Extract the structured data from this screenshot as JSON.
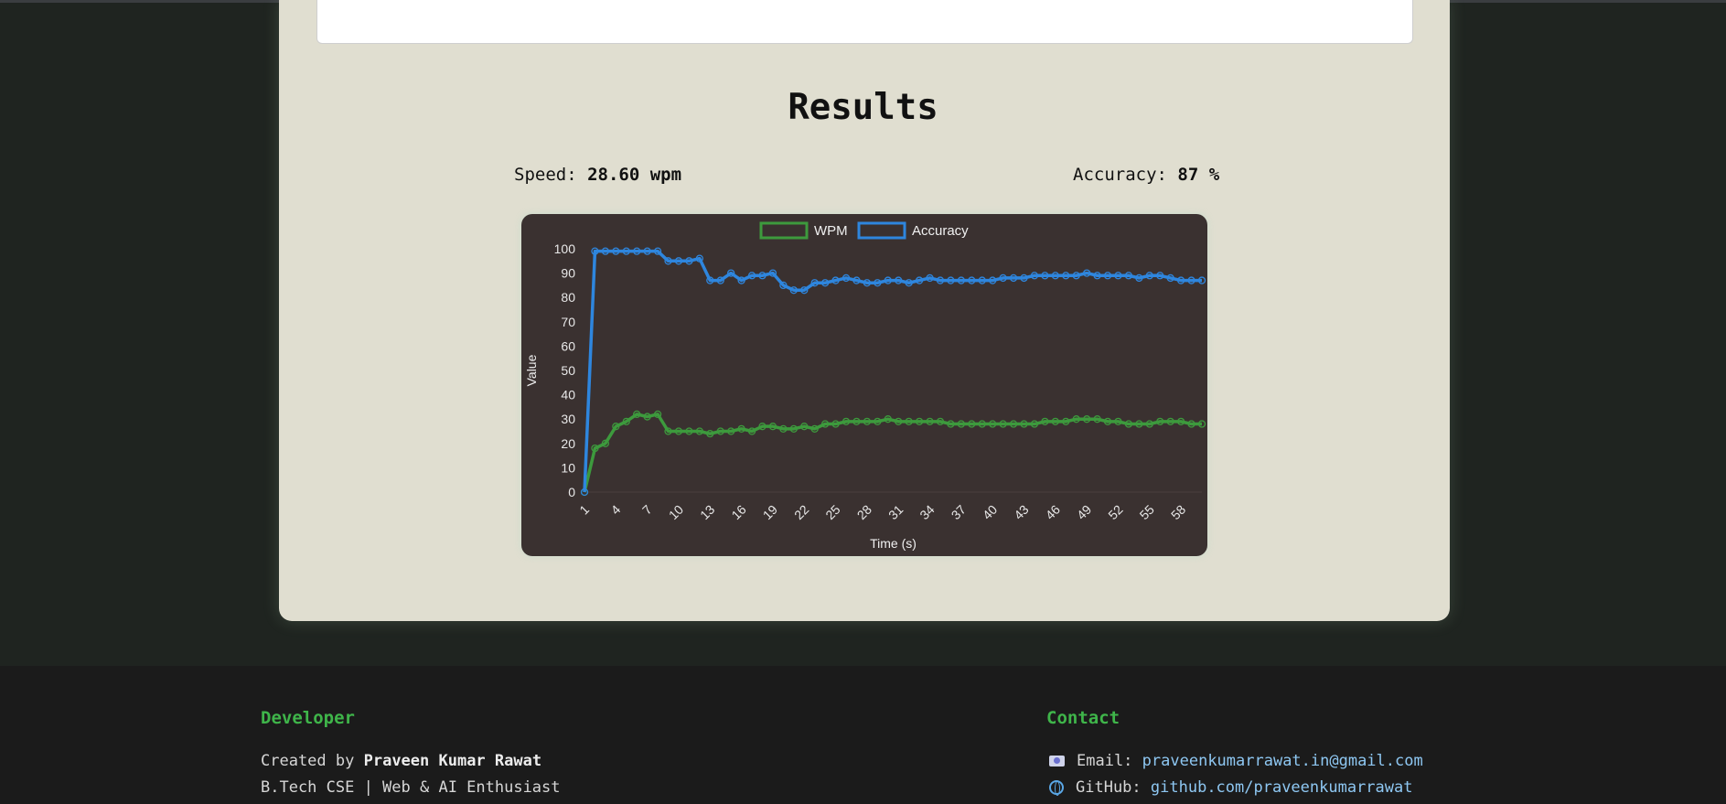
{
  "results": {
    "title": "Results",
    "speed_label": "Speed:",
    "speed_value": "28.60 wpm",
    "accuracy_label": "Accuracy:",
    "accuracy_value": "87 %"
  },
  "chart_data": {
    "type": "line",
    "xlabel": "Time (s)",
    "ylabel": "Value",
    "ylim": [
      0,
      100
    ],
    "y_ticks": [
      0,
      10,
      20,
      30,
      40,
      50,
      60,
      70,
      80,
      90,
      100
    ],
    "x_tick_labels": [
      "1",
      "4",
      "7",
      "10",
      "13",
      "16",
      "19",
      "22",
      "25",
      "28",
      "31",
      "34",
      "37",
      "40",
      "43",
      "46",
      "49",
      "52",
      "55",
      "58"
    ],
    "legend": "top-center",
    "x": [
      1,
      2,
      3,
      4,
      5,
      6,
      7,
      8,
      9,
      10,
      11,
      12,
      13,
      14,
      15,
      16,
      17,
      18,
      19,
      20,
      21,
      22,
      23,
      24,
      25,
      26,
      27,
      28,
      29,
      30,
      31,
      32,
      33,
      34,
      35,
      36,
      37,
      38,
      39,
      40,
      41,
      42,
      43,
      44,
      45,
      46,
      47,
      48,
      49,
      50,
      51,
      52,
      53,
      54,
      55,
      56,
      57,
      58,
      59,
      60
    ],
    "series": [
      {
        "name": "WPM",
        "color": "#3d9a3d",
        "values": [
          0,
          18,
          20,
          27,
          29,
          32,
          31,
          32,
          25,
          25,
          25,
          25,
          24,
          25,
          25,
          26,
          25,
          27,
          27,
          26,
          26,
          27,
          26,
          28,
          28,
          29,
          29,
          29,
          29,
          30,
          29,
          29,
          29,
          29,
          29,
          28,
          28,
          28,
          28,
          28,
          28,
          28,
          28,
          28,
          29,
          29,
          29,
          30,
          30,
          30,
          29,
          29,
          28,
          28,
          28,
          29,
          29,
          29,
          28,
          28
        ]
      },
      {
        "name": "Accuracy",
        "color": "#2e86de",
        "values": [
          0,
          99,
          99,
          99,
          99,
          99,
          99,
          99,
          95,
          95,
          95,
          96,
          87,
          87,
          90,
          87,
          89,
          89,
          90,
          85,
          83,
          83,
          86,
          86,
          87,
          88,
          87,
          86,
          86,
          87,
          87,
          86,
          87,
          88,
          87,
          87,
          87,
          87,
          87,
          87,
          88,
          88,
          88,
          89,
          89,
          89,
          89,
          89,
          90,
          89,
          89,
          89,
          89,
          88,
          89,
          89,
          88,
          87,
          87,
          87
        ]
      }
    ]
  },
  "footer": {
    "developer_heading": "Developer",
    "created_by": "Created by",
    "author": "Praveen Kumar Rawat",
    "tagline": "B.Tech CSE | Web & AI Enthusiast",
    "contact_heading": "Contact",
    "email_label": "Email:",
    "email_value": "praveenkumarrawat.in@gmail.com",
    "github_label": "GitHub:",
    "github_value": "github.com/praveenkumarrawat",
    "email_icon": "email-icon",
    "github_icon": "globe-icon"
  }
}
